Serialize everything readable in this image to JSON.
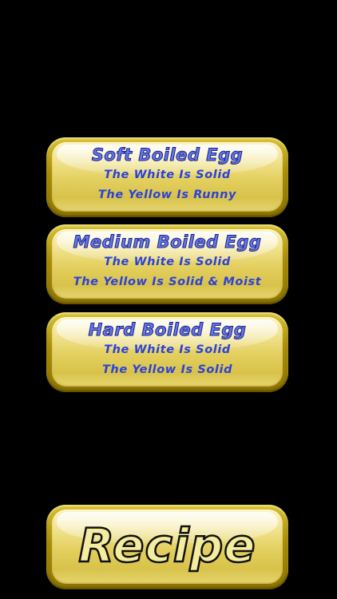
{
  "options": [
    {
      "title": "Soft Boiled Egg",
      "line1": "The White Is Solid",
      "line2": "The Yellow Is Runny"
    },
    {
      "title": "Medium Boiled Egg",
      "line1": "The White Is Solid",
      "line2": "The Yellow Is Solid & Moist"
    },
    {
      "title": "Hard Boiled Egg",
      "line1": "The White Is Solid",
      "line2": "The Yellow Is Solid"
    }
  ],
  "recipe_button": {
    "label": "Recipe"
  },
  "colors": {
    "background": "#000000",
    "button_gold": "#c2a91b",
    "title_text": "#6677e6",
    "body_text": "#2b41d9"
  }
}
